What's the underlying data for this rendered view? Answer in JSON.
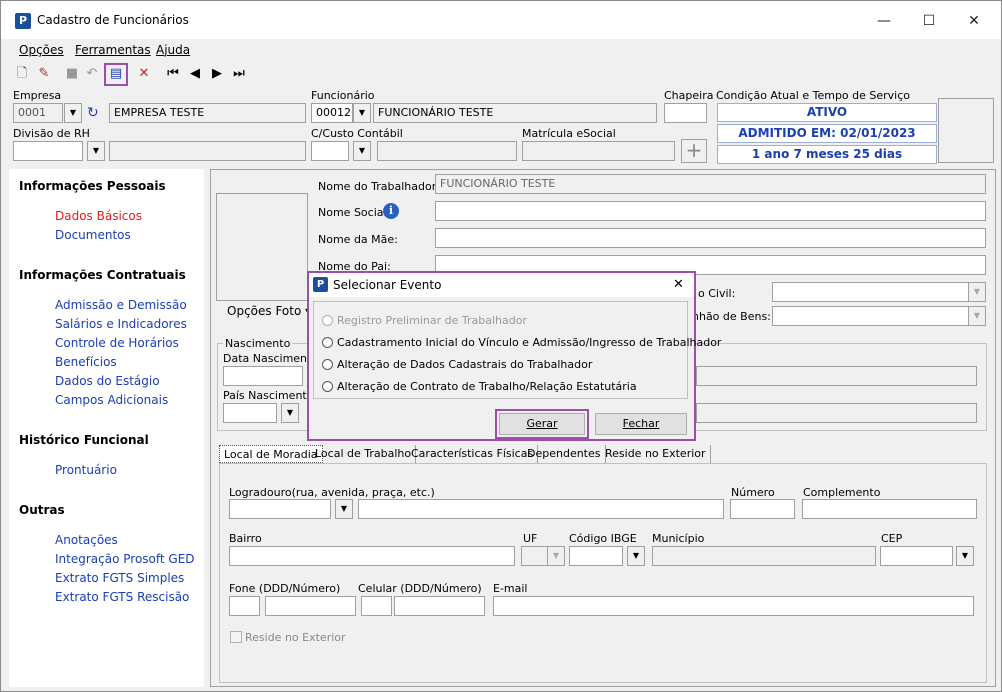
{
  "window": {
    "title": "Cadastro de Funcionários",
    "app_icon": "P",
    "minimize": "—",
    "maximize": "☐",
    "close": "✕"
  },
  "menu": [
    "Opções",
    "Ferramentas",
    "Ajuda"
  ],
  "header": {
    "empresa_label": "Empresa",
    "empresa_code": "0001",
    "empresa_name": "EMPRESA TESTE",
    "funcionario_label": "Funcionário",
    "funcionario_code": "00012",
    "funcionario_name": "FUNCIONÁRIO TESTE",
    "chapeira_label": "Chapeira",
    "condicao_label": "Condição Atual e Tempo de Serviço",
    "status_ativo": "ATIVO",
    "admitido": "ADMITIDO EM: 02/01/2023",
    "tempo_servico": "1 ano 7 meses 25 dias",
    "divisao_label": "Divisão de RH",
    "ccusto_label": "C/Custo Contábil",
    "matricula_label": "Matrícula eSocial",
    "add_symbol": "+"
  },
  "sidebar": {
    "sections": [
      {
        "title": "Informações Pessoais",
        "items": [
          "Dados Básicos",
          "Documentos"
        ]
      },
      {
        "title": "Informações Contratuais",
        "items": [
          "Admissão e Demissão",
          "Salários e Indicadores",
          "Controle de Horários",
          "Benefícios",
          "Dados do Estágio",
          "Campos Adicionais"
        ]
      },
      {
        "title": "Histórico Funcional",
        "items": [
          "Prontuário"
        ]
      },
      {
        "title": "Outras",
        "items": [
          "Anotações",
          "Integração Prosoft GED",
          "Extrato FGTS Simples",
          "Extrato FGTS Rescisão"
        ]
      }
    ],
    "active_color": "#e0201b",
    "link_color": "#1a3fb0"
  },
  "form": {
    "nome_trabalhador_label": "Nome do Trabalhador:",
    "nome_trabalhador_value": "FUNCIONÁRIO TESTE",
    "nome_social_label": "Nome Social:",
    "nome_mae_label": "Nome da Mãe:",
    "nome_pai_label": "Nome do Pai:",
    "estado_civil_label": "o Civil:",
    "regime_bens_label": "nhão de Bens:",
    "opcoes_foto": "Opções Foto ▾",
    "nascimento_label": "Nascimento",
    "data_nasc_label": "Data Nascimento",
    "pais_nasc_label": "País Nascimento"
  },
  "tabs": [
    "Local de Moradia",
    "Local de Trabalho",
    "Características Físicas",
    "Dependentes",
    "Reside no Exterior"
  ],
  "moradia": {
    "logradouro_label": "Logradouro(rua, avenida, praça, etc.)",
    "numero_label": "Número",
    "complemento_label": "Complemento",
    "bairro_label": "Bairro",
    "uf_label": "UF",
    "ibge_label": "Código IBGE",
    "municipio_label": "Município",
    "cep_label": "CEP",
    "fone_label": "Fone (DDD/Número)",
    "celular_label": "Celular (DDD/Número)",
    "email_label": "E-mail",
    "reside_exterior_label": "Reside no Exterior"
  },
  "dialog": {
    "title": "Selecionar Evento",
    "close": "✕",
    "options": [
      {
        "label": "Registro Preliminar de Trabalhador",
        "disabled": true
      },
      {
        "label": "Cadastramento Inicial do Vínculo e Admissão/Ingresso de Trabalhador",
        "disabled": false
      },
      {
        "label": "Alteração de Dados Cadastrais do Trabalhador",
        "disabled": false
      },
      {
        "label": "Alteração de Contrato de Trabalho/Relação Estatutária",
        "disabled": false
      }
    ],
    "gerar": "Gerar",
    "fechar": "Fechar"
  },
  "highlight_color": "#9b4fa8"
}
